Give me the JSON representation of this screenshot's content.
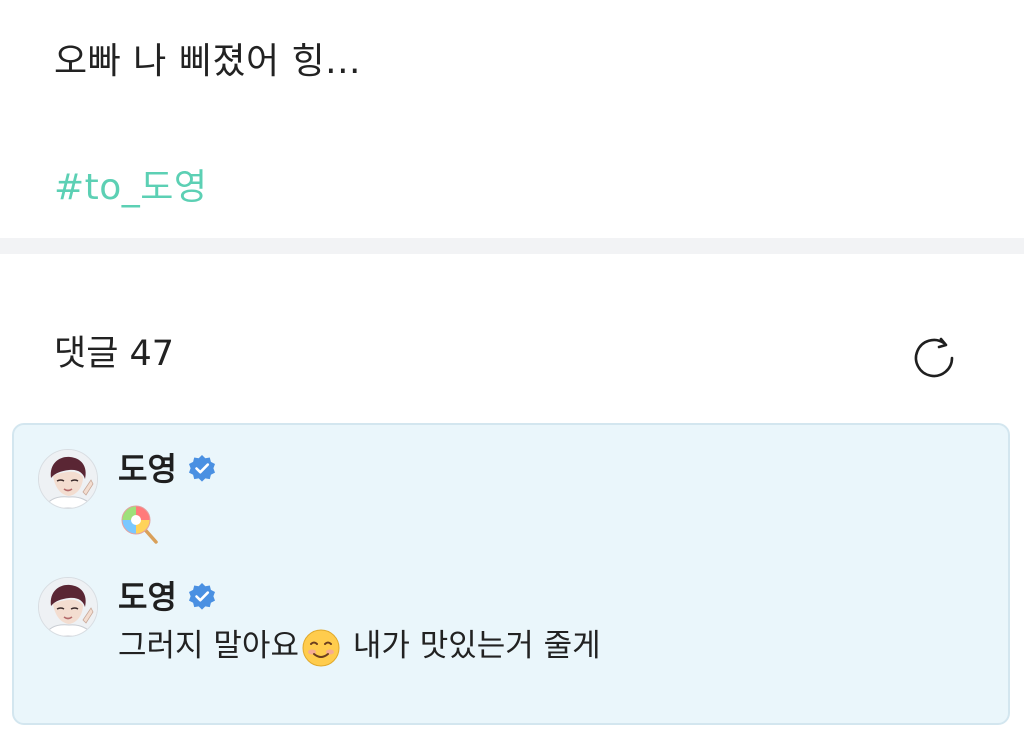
{
  "post": {
    "text": "오빠 나 삐졌어 힝...",
    "hashtag": "#to_도영"
  },
  "comments_section": {
    "title": "댓글 47",
    "refresh_icon": "refresh-icon"
  },
  "comments": [
    {
      "author": "도영",
      "verified": true,
      "avatar_icon": "avatar",
      "body": "🍭"
    },
    {
      "author": "도영",
      "verified": true,
      "avatar_icon": "avatar",
      "body_before": "그러지 말아요",
      "body_after": " 내가 맛있는거 줄게"
    }
  ],
  "colors": {
    "hashtag": "#5cd0b4",
    "comment_bg": "#eaf6fb",
    "comment_border": "#d3e6ef",
    "verified": "#4a90e2",
    "divider": "#f2f3f5"
  }
}
